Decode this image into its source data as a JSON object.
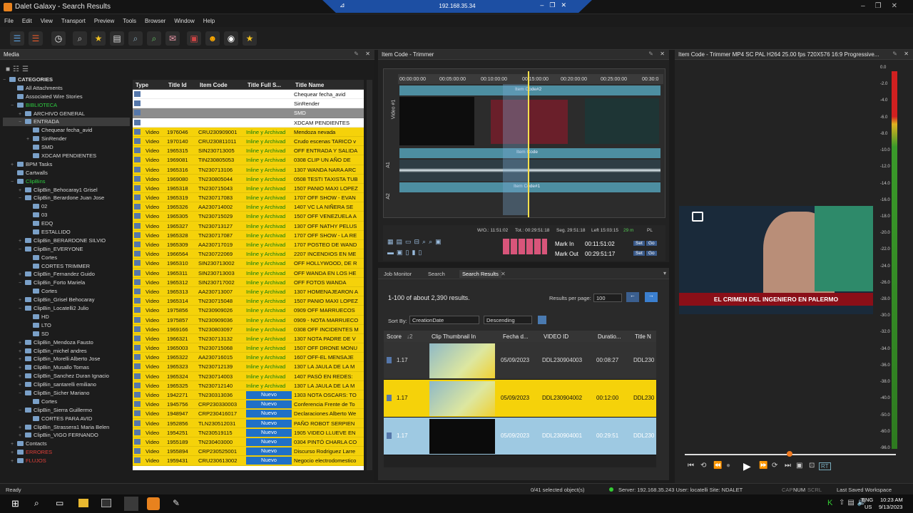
{
  "window": {
    "title": "Dalet Galaxy - Search Results",
    "rdp_ip": "192.168.35.34"
  },
  "menu": [
    "File",
    "Edit",
    "View",
    "Transport",
    "Preview",
    "Tools",
    "Browser",
    "Window",
    "Help"
  ],
  "media_panel": {
    "title": "Media"
  },
  "tree": [
    {
      "label": "CATEGORIES",
      "level": 0,
      "exp": "−",
      "bold": true
    },
    {
      "label": "All Attachments",
      "level": 1,
      "exp": ""
    },
    {
      "label": "Associated Wire Stories",
      "level": 1,
      "exp": ""
    },
    {
      "label": "BIBLIOTECA",
      "level": 1,
      "exp": "−",
      "color": "#2ecc40"
    },
    {
      "label": "ARCHIVO GENERAL",
      "level": 2,
      "exp": "+"
    },
    {
      "label": "ENTRADA",
      "level": 2,
      "exp": "−",
      "sel": true
    },
    {
      "label": "Chequear fecha_avid",
      "level": 3,
      "exp": ""
    },
    {
      "label": "SinRender",
      "level": 3,
      "exp": "+"
    },
    {
      "label": "SMD",
      "level": 3,
      "exp": ""
    },
    {
      "label": "XDCAM PENDIENTES",
      "level": 3,
      "exp": ""
    },
    {
      "label": "BPM Tasks",
      "level": 1,
      "exp": "+"
    },
    {
      "label": "Cartwalls",
      "level": 1,
      "exp": ""
    },
    {
      "label": "ClipBins",
      "level": 1,
      "exp": "−",
      "color": "#2ecc40"
    },
    {
      "label": "ClipBin_Behocaray1 Grisel",
      "level": 2,
      "exp": "+"
    },
    {
      "label": "ClipBin_Berardone Juan Jose",
      "level": 2,
      "exp": "−"
    },
    {
      "label": "02",
      "level": 3,
      "exp": ""
    },
    {
      "label": "03",
      "level": 3,
      "exp": ""
    },
    {
      "label": "EDQ",
      "level": 3,
      "exp": ""
    },
    {
      "label": "ESTALLIDO",
      "level": 3,
      "exp": ""
    },
    {
      "label": "ClipBin_BERARDONE SILVIO",
      "level": 2,
      "exp": "+"
    },
    {
      "label": "ClipBin_EVERYONE",
      "level": 2,
      "exp": "−"
    },
    {
      "label": "Cortes",
      "level": 3,
      "exp": ""
    },
    {
      "label": "CORTES TRIMMER",
      "level": 3,
      "exp": ""
    },
    {
      "label": "ClipBin_Fernandez Guido",
      "level": 2,
      "exp": "+"
    },
    {
      "label": "ClipBin_Forto Mariela",
      "level": 2,
      "exp": "−"
    },
    {
      "label": "Cortes",
      "level": 3,
      "exp": ""
    },
    {
      "label": "ClipBin_Grisel Behocaray",
      "level": 2,
      "exp": "+"
    },
    {
      "label": "ClipBin_Locatelli2 Julio",
      "level": 2,
      "exp": "−"
    },
    {
      "label": "HD",
      "level": 3,
      "exp": ""
    },
    {
      "label": "LTO",
      "level": 3,
      "exp": ""
    },
    {
      "label": "SD",
      "level": 3,
      "exp": ""
    },
    {
      "label": "ClipBin_Mendoza Fausto",
      "level": 2,
      "exp": "+"
    },
    {
      "label": "ClipBin_michel andres",
      "level": 2,
      "exp": "+"
    },
    {
      "label": "ClipBin_Morelli Alberto Jose",
      "level": 2,
      "exp": "+"
    },
    {
      "label": "ClipBin_Musallo Tomas",
      "level": 2,
      "exp": "+"
    },
    {
      "label": "ClipBin_Sanchez Duran Ignacio",
      "level": 2,
      "exp": "+"
    },
    {
      "label": "ClipBin_santarelli emiliano",
      "level": 2,
      "exp": "+"
    },
    {
      "label": "ClipBin_Sicher Mariano",
      "level": 2,
      "exp": "−"
    },
    {
      "label": "Cortes",
      "level": 3,
      "exp": ""
    },
    {
      "label": "ClipBin_Sierra Guillermo",
      "level": 2,
      "exp": "−"
    },
    {
      "label": "CORTES PARA AVID",
      "level": 3,
      "exp": ""
    },
    {
      "label": "ClipBin_Strassera1 Maria Belen",
      "level": 2,
      "exp": "+"
    },
    {
      "label": "ClipBin_VIGO FERNANDO",
      "level": 2,
      "exp": "+"
    },
    {
      "label": "Contacts",
      "level": 1,
      "exp": "+"
    },
    {
      "label": "ERRORES",
      "level": 1,
      "exp": "+",
      "color": "#e0403a"
    },
    {
      "label": "FLUJOS",
      "level": 1,
      "exp": "+",
      "color": "#e0403a"
    }
  ],
  "grid": {
    "headers": [
      "Type",
      "Title Id",
      "Item Code",
      "Title Full S...",
      "Title Name"
    ],
    "rows": [
      {
        "c": "w",
        "type": "",
        "id": "",
        "code": "",
        "status": "",
        "name": "Chequear fecha_avid"
      },
      {
        "c": "w",
        "type": "",
        "id": "",
        "code": "",
        "status": "",
        "name": "SinRender"
      },
      {
        "c": "g",
        "type": "",
        "id": "",
        "code": "",
        "status": "",
        "name": "SMD"
      },
      {
        "c": "w",
        "type": "",
        "id": "",
        "code": "",
        "status": "",
        "name": "XDCAM PENDIENTES"
      },
      {
        "c": "y",
        "type": "Video",
        "id": "1976046",
        "code": "CRU230909001",
        "status": "Inline y Archivad",
        "name": "Mendoza nevada"
      },
      {
        "c": "y",
        "type": "Video",
        "id": "1970140",
        "code": "CRU230811011",
        "status": "Inline y Archivad",
        "name": "Crudo escenas TARICO v"
      },
      {
        "c": "y",
        "type": "Video",
        "id": "1965315",
        "code": "SIN230713005",
        "status": "Inline y Archivad",
        "name": "OFF ENTRADA Y SALIDA"
      },
      {
        "c": "y",
        "type": "Video",
        "id": "1969081",
        "code": "TIN230805053",
        "status": "Inline y Archivad",
        "name": "0308 CLIP UN AÑO DE"
      },
      {
        "c": "y",
        "type": "Video",
        "id": "1965316",
        "code": "TN230713106",
        "status": "Inline y Archivad",
        "name": "1307 WANDA NARA ARC"
      },
      {
        "c": "y",
        "type": "Video",
        "id": "1969080",
        "code": "TN230805044",
        "status": "Inline y Archivad",
        "name": "0508 TESTI TAXISTA TUB"
      },
      {
        "c": "y",
        "type": "Video",
        "id": "1965318",
        "code": "TN230715043",
        "status": "Inline y Archivad",
        "name": "1507 PANIO MAXI LOPEZ"
      },
      {
        "c": "y",
        "type": "Video",
        "id": "1965319",
        "code": "TN230717083",
        "status": "Inline y Archivad",
        "name": "1707 OFF SHOW - EVAN"
      },
      {
        "c": "y",
        "type": "Video",
        "id": "1965326",
        "code": "AA230714002",
        "status": "Inline y Archivad",
        "name": "1407 VC LA NIÑERA SE"
      },
      {
        "c": "y",
        "type": "Video",
        "id": "1965305",
        "code": "TN230715029",
        "status": "Inline y Archivad",
        "name": "1507 OFF VENEZUELA A"
      },
      {
        "c": "y",
        "type": "Video",
        "id": "1965327",
        "code": "TN230713127",
        "status": "Inline y Archivad",
        "name": "1307 OFF NATHY PELUS"
      },
      {
        "c": "y",
        "type": "Video",
        "id": "1965328",
        "code": "TN230717087",
        "status": "Inline y Archivad",
        "name": "1707 OFF SHOW - LA RE"
      },
      {
        "c": "y",
        "type": "Video",
        "id": "1965309",
        "code": "AA230717019",
        "status": "Inline y Archivad",
        "name": "1707 POSTEO DE WAND"
      },
      {
        "c": "y",
        "type": "Video",
        "id": "1966564",
        "code": "TN230722069",
        "status": "Inline y Archivad",
        "name": "2207 INCENDIOS EN ME"
      },
      {
        "c": "y",
        "type": "Video",
        "id": "1965310",
        "code": "SIN230713002",
        "status": "Inline y Archivad",
        "name": "OFF HOLLYWOOD, DE R"
      },
      {
        "c": "y",
        "type": "Video",
        "id": "1965311",
        "code": "SIN230713003",
        "status": "Inline y Archivad",
        "name": "OFF WANDA EN LOS HE"
      },
      {
        "c": "y",
        "type": "Video",
        "id": "1965312",
        "code": "SIN230717002",
        "status": "Inline y Archivad",
        "name": "OFF FOTOS WANDA"
      },
      {
        "c": "y",
        "type": "Video",
        "id": "1965313",
        "code": "AA230713007",
        "status": "Inline y Archivad",
        "name": "1307 HOMENAJEARON A"
      },
      {
        "c": "y",
        "type": "Video",
        "id": "1965314",
        "code": "TN230715048",
        "status": "Inline y Archivad",
        "name": "1507 PANIO MAXI LOPEZ"
      },
      {
        "c": "y",
        "type": "Video",
        "id": "1975856",
        "code": "TN230909026",
        "status": "Inline y Archivad",
        "name": "0909 OFF MARRUECOS"
      },
      {
        "c": "y",
        "type": "Video",
        "id": "1975857",
        "code": "TN230909036",
        "status": "Inline y Archivad",
        "name": "0909 - NOTA MARRUECO"
      },
      {
        "c": "y",
        "type": "Video",
        "id": "1969166",
        "code": "TN230803097",
        "status": "Inline y Archivad",
        "name": "0308 OFF INCIDENTES M"
      },
      {
        "c": "y",
        "type": "Video",
        "id": "1966321",
        "code": "TN230713132",
        "status": "Inline y Archivad",
        "name": "1307 NOTA PADRE DE V"
      },
      {
        "c": "y",
        "type": "Video",
        "id": "1965003",
        "code": "TN230715068",
        "status": "Inline y Archivad",
        "name": "1507 OFF DRONE MONU"
      },
      {
        "c": "y",
        "type": "Video",
        "id": "1965322",
        "code": "AA230716015",
        "status": "Inline y Archivad",
        "name": "1607 OFF-EL MENSAJE"
      },
      {
        "c": "y",
        "type": "Video",
        "id": "1965323",
        "code": "TN230712139",
        "status": "Inline y Archivad",
        "name": "1307 LA JAULA DE LA M"
      },
      {
        "c": "y",
        "type": "Video",
        "id": "1965324",
        "code": "TN230714003",
        "status": "Inline y Archivad",
        "name": "1407 PASÓ EN REDES:"
      },
      {
        "c": "y",
        "type": "Video",
        "id": "1965325",
        "code": "TN230712140",
        "status": "Inline y Archivad",
        "name": "1307 LA JAULA DE LA M"
      },
      {
        "c": "y",
        "type": "Video",
        "id": "1942271",
        "code": "TN230313036",
        "status": "Nuevo",
        "name": "1303 NOTA OSCARS: TO"
      },
      {
        "c": "y",
        "type": "Video",
        "id": "1945756",
        "code": "CRP230330003",
        "status": "Nuevo",
        "name": "Conferencia Frente de To"
      },
      {
        "c": "y",
        "type": "Video",
        "id": "1948947",
        "code": "CRP230416017",
        "status": "Nuevo",
        "name": "Declaraciones Alberto We"
      },
      {
        "c": "y",
        "type": "Video",
        "id": "1952856",
        "code": "TLN230512031",
        "status": "Nuevo",
        "name": "PAÑO ROBOT SERPIEN"
      },
      {
        "c": "y",
        "type": "Video",
        "id": "1954251",
        "code": "TN230519115",
        "status": "Nuevo",
        "name": "1905 VIDEO LLUEVE EN"
      },
      {
        "c": "y",
        "type": "Video",
        "id": "1955189",
        "code": "TN230403000",
        "status": "Nuevo",
        "name": "0304 PINTÓ CHARLA CO"
      },
      {
        "c": "y",
        "type": "Video",
        "id": "1955894",
        "code": "CRP230525001",
        "status": "Nuevo",
        "name": "Discurso Rodriguez Larre"
      },
      {
        "c": "y",
        "type": "Video",
        "id": "1959431",
        "code": "CRU230613002",
        "status": "Nuevo",
        "name": "Negocio electrodomestico"
      }
    ]
  },
  "trimmer": {
    "title": "Item Code - Trimmer",
    "ruler": [
      "00:00:00:00",
      "00:05:00:00",
      "00:10:00:00",
      "00:15:00:00",
      "00:20:00:00",
      "00:25:00:00",
      "00:30:0"
    ],
    "tracks": [
      "Video #1",
      "A1",
      "A2"
    ],
    "clip_label_top": "Item Code#2",
    "clip_label_mid": "Item Code",
    "clip_label_low": "Item Code#1",
    "info_wo": "W/O.: 11:51:02",
    "info_tot": "Tot.: 00:29:51:18",
    "info_seg": "Seg. 29:51:18",
    "info_left": "Left 15:03:15",
    "info_fps": "29 m",
    "info_std": "PL",
    "mark_in_label": "Mark In",
    "mark_in": "00:11:51:02",
    "mark_out_label": "Mark Out",
    "mark_out": "00:29:51:17",
    "set_label": "Set",
    "go_label": "Go"
  },
  "search": {
    "tabs": [
      "Job Monitor",
      "Search",
      "Search Results"
    ],
    "summary": "1-100 of about 2,390 results.",
    "per_page_label": "Results per page:",
    "per_page": "100",
    "sort_label": "Sort By:",
    "sort_field": "CreationDate",
    "sort_dir": "Descending",
    "headers": [
      "Score",
      "↓2",
      "Clip Thumbnail In",
      "Fecha d...",
      "VIDEO ID",
      "Duratio...",
      "Title N"
    ],
    "rows": [
      {
        "score": "1.17",
        "date": "05/09/2023",
        "vid": "DDL230904003",
        "dur": "00:08:27",
        "title": "DDL230",
        "bg": "#333333",
        "fg": "#dddddd"
      },
      {
        "score": "1.17",
        "date": "05/09/2023",
        "vid": "DDL230904002",
        "dur": "00:12:00",
        "title": "DDL230",
        "bg": "#f5d20a",
        "fg": "#111111"
      },
      {
        "score": "1.17",
        "date": "05/09/2023",
        "vid": "DDL230904001",
        "dur": "00:29:51",
        "title": "DDL230",
        "bg": "#9ec9e2",
        "fg": "#ffffff"
      }
    ]
  },
  "viewer": {
    "title": "Item Code - Trimmer MP4 SC PAL H264 25.00 fps 720X576 16:9 Progressive...",
    "caption": "EL CRIMEN DEL INGENIERO EN PALERMO",
    "meter_ticks": [
      "0.0",
      "-2.0",
      "-4.0",
      "-6.0",
      "-8.0",
      "-10.0",
      "-12.0",
      "-14.0",
      "-16.0",
      "-18.0",
      "-20.0",
      "-22.0",
      "-24.0",
      "-26.0",
      "-28.0",
      "-30.0",
      "-32.0",
      "-34.0",
      "-36.0",
      "-38.0",
      "-40.0",
      "-50.0",
      "-60.0",
      "-96.0"
    ],
    "rt_label": "RT"
  },
  "status": {
    "left": "Ready",
    "selected": "0/41 selected object(s)",
    "server": "Server: 192.168.35.243 User: locatelli Site: NDALET",
    "caps": "CAP",
    "num": "NUM",
    "scrl": "SCRL",
    "saved": "Last Saved Workspace"
  },
  "taskbar": {
    "lang": "ENG",
    "region": "US",
    "time": "10:23 AM",
    "date": "9/13/2023"
  },
  "colors": {
    "yellow": "#f5d20a",
    "nuevo": "#1f70c7",
    "inline_text": "#0d7d0d",
    "accent": "#1d4fa3"
  }
}
